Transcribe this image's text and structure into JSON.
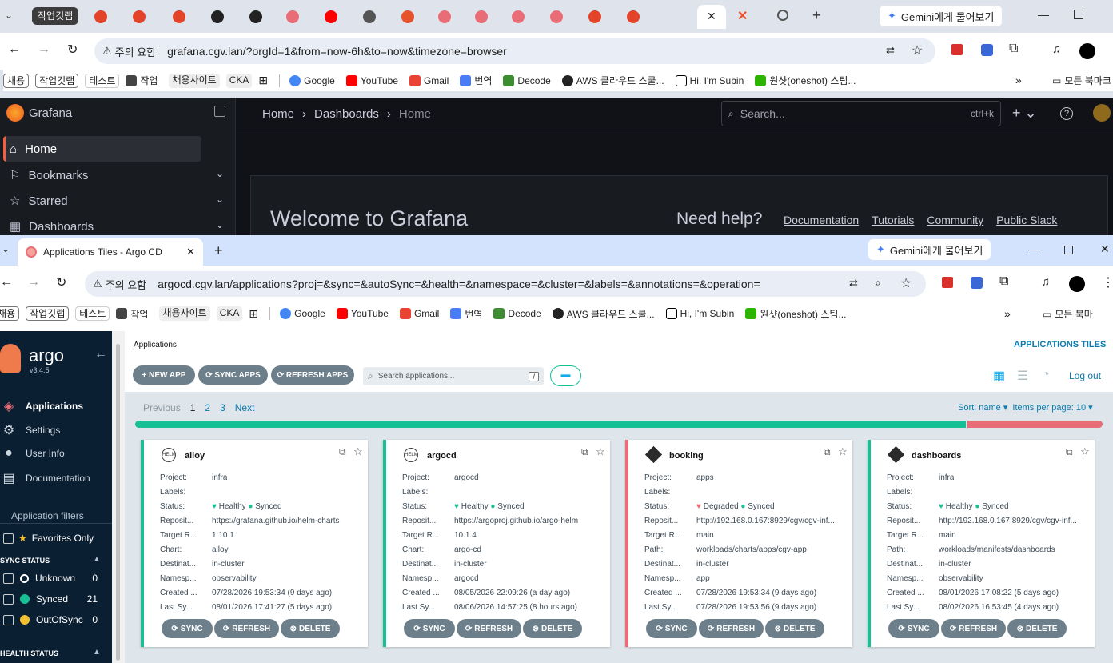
{
  "browser1": {
    "group_labels": [
      "작업깃랩"
    ],
    "url": "grafana.cgv.lan/?orgId=1&from=now-6h&to=now&timezone=browser",
    "warning": "주의 요함",
    "gemini": "Gemini에게 물어보기",
    "shortcut": "ctrl+k"
  },
  "bookmarks": {
    "chips": [
      "채용",
      "작업깃랩",
      "테스트"
    ],
    "items": [
      "작업",
      "채용사이트",
      "CKA"
    ],
    "links": [
      "Google",
      "YouTube",
      "Gmail",
      "번역",
      "Decode",
      "AWS 클라우드 스쿨...",
      "Hi, I'm Subin",
      "원샷(oneshot) 스팀..."
    ],
    "all": "모든 북마크",
    "all2": "모든 북마"
  },
  "grafana": {
    "brand": "Grafana",
    "nav": [
      "Home",
      "Bookmarks",
      "Starred",
      "Dashboards"
    ],
    "breadcrumb": [
      "Home",
      "Dashboards",
      "Home"
    ],
    "search_placeholder": "Search...",
    "welcome": "Welcome to Grafana",
    "help": "Need help?",
    "help_links": [
      "Documentation",
      "Tutorials",
      "Community",
      "Public Slack"
    ]
  },
  "browser2": {
    "tab_title": "Applications Tiles - Argo CD",
    "url": "argocd.cgv.lan/applications?proj=&sync=&autoSync=&health=&namespace=&cluster=&labels=&annotations=&operation=",
    "warning": "주의 요함",
    "gemini": "Gemini에게 물어보기"
  },
  "argo": {
    "logo": "argo",
    "version": "v3.4.5",
    "nav": [
      "Applications",
      "Settings",
      "User Info",
      "Documentation"
    ],
    "filters_title": "Application filters",
    "favorites": "Favorites Only",
    "sync_status_title": "SYNC STATUS",
    "sync_status": [
      {
        "label": "Unknown",
        "count": "0"
      },
      {
        "label": "Synced",
        "count": "21"
      },
      {
        "label": "OutOfSync",
        "count": "0"
      }
    ],
    "health_status_title": "HEALTH STATUS",
    "breadcrumb": "Applications",
    "view_title": "APPLICATIONS TILES",
    "buttons": {
      "new": "NEW APP",
      "sync": "SYNC APPS",
      "refresh": "REFRESH APPS"
    },
    "search_placeholder": "Search applications...",
    "search_key": "/",
    "logout": "Log out",
    "pagination": {
      "prev": "Previous",
      "pages": [
        "1",
        "2",
        "3"
      ],
      "next": "Next"
    },
    "sort": "Sort: name",
    "per_page": "Items per page: 10",
    "health_progress": {
      "healthy": 0.86,
      "degraded": 0.14
    },
    "card_buttons": [
      "SYNC",
      "REFRESH",
      "DELETE"
    ],
    "apps": [
      {
        "name": "alloy",
        "type": "HELM",
        "project": "infra",
        "labels": "",
        "status_health": "Healthy",
        "status_sync": "Synced",
        "repo": "https://grafana.github.io/helm-charts",
        "target": "1.10.1",
        "third_key": "Chart:",
        "third": "alloy",
        "dest": "in-cluster",
        "ns": "observability",
        "created": "07/28/2026 19:53:34  (9 days ago)",
        "last_sync": "08/01/2026 17:41:27  (5 days ago)"
      },
      {
        "name": "argocd",
        "type": "HELM",
        "project": "argocd",
        "labels": "",
        "status_health": "Healthy",
        "status_sync": "Synced",
        "repo": "https://argoproj.github.io/argo-helm",
        "target": "10.1.4",
        "third_key": "Chart:",
        "third": "argo-cd",
        "dest": "in-cluster",
        "ns": "argocd",
        "created": "08/05/2026 22:09:26  (a day ago)",
        "last_sync": "08/06/2026 14:57:25  (8 hours ago)"
      },
      {
        "name": "booking",
        "type": "GIT",
        "project": "apps",
        "labels": "",
        "status_health": "Degraded",
        "status_sync": "Synced",
        "repo": "http://192.168.0.167:8929/cgv/cgv-inf...",
        "target": "main",
        "third_key": "Path:",
        "third": "workloads/charts/apps/cgv-app",
        "dest": "in-cluster",
        "ns": "app",
        "created": "07/28/2026 19:53:34  (9 days ago)",
        "last_sync": "07/28/2026 19:53:56  (9 days ago)"
      },
      {
        "name": "dashboards",
        "type": "GIT",
        "project": "infra",
        "labels": "",
        "status_health": "Healthy",
        "status_sync": "Synced",
        "repo": "http://192.168.0.167:8929/cgv/cgv-inf...",
        "target": "main",
        "third_key": "Path:",
        "third": "workloads/manifests/dashboards",
        "dest": "in-cluster",
        "ns": "observability",
        "created": "08/01/2026 17:08:22  (5 days ago)",
        "last_sync": "08/02/2026 16:53:45  (4 days ago)"
      }
    ],
    "field_keys": [
      "Project:",
      "Labels:",
      "Status:",
      "Reposit...",
      "Target R...",
      "",
      "Destinat...",
      "Namesp...",
      "Created ...",
      "Last Sy..."
    ]
  },
  "colors": {
    "healthy": "#18be94",
    "degraded": "#e96d76",
    "argo_sidebar": "#0dadea",
    "argo_accent": "#0dadea",
    "grafana_bg": "#111217"
  }
}
